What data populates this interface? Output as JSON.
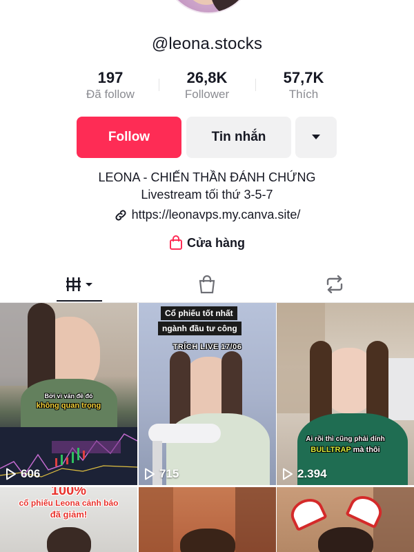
{
  "profile": {
    "username": "@leona.stocks",
    "bio_line1": "LEONA - CHIẾN THẦN ĐÁNH CHỨNG",
    "bio_line2": "Livestream tối thứ 3-5-7",
    "link": "https://leonavps.my.canva.site/",
    "shop_label": "Cửa hàng"
  },
  "stats": [
    {
      "value": "197",
      "label": "Đã follow"
    },
    {
      "value": "26,8K",
      "label": "Follower"
    },
    {
      "value": "57,7K",
      "label": "Thích"
    }
  ],
  "actions": {
    "follow_label": "Follow",
    "message_label": "Tin nhắn",
    "more_icon": "caret-down-icon"
  },
  "tabs": [
    {
      "icon": "videos-grid-icon"
    },
    {
      "icon": "shop-bag-icon"
    },
    {
      "icon": "repost-icon"
    }
  ],
  "videos": [
    {
      "views": "606",
      "caption_a": "Bởi vì vấn đề đó",
      "caption_b": "không quan trọng"
    },
    {
      "views": "715",
      "caption_a": "Cổ phiếu tốt nhất",
      "caption_b": "ngành đầu tư công",
      "caption_c": "TRÍCH LIVE 17/06"
    },
    {
      "views": "2.394",
      "caption_a": "Ai rồi thì cũng phải dính",
      "caption_b": "BULLTRAP",
      "caption_c": "mà thôi"
    },
    {
      "caption_a": "100%",
      "caption_b": "cổ phiếu Leona cảnh báo",
      "caption_c": "đã giảm!"
    },
    {},
    {}
  ],
  "colors": {
    "accent": "#fe2c55",
    "secondary_button": "#f1f1f2",
    "text_primary": "#161823",
    "text_muted": "#8a8b91"
  }
}
